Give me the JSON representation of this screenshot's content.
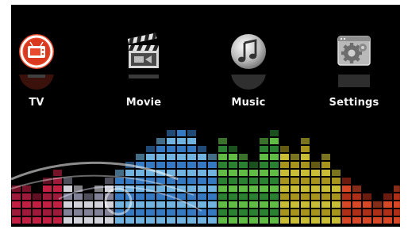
{
  "menu": {
    "items": [
      {
        "id": "tv",
        "label": "TV",
        "icon": "tv-icon",
        "selected": true
      },
      {
        "id": "movie",
        "label": "Movie",
        "icon": "clapperboard-icon"
      },
      {
        "id": "music",
        "label": "Music",
        "icon": "music-note-icon"
      },
      {
        "id": "settings",
        "label": "Settings",
        "icon": "gear-icon"
      }
    ]
  },
  "colors": {
    "background": "#000000",
    "tv_icon": "#e8492c",
    "label": "#f2f2f2"
  },
  "background_art": "equalizer-bars"
}
